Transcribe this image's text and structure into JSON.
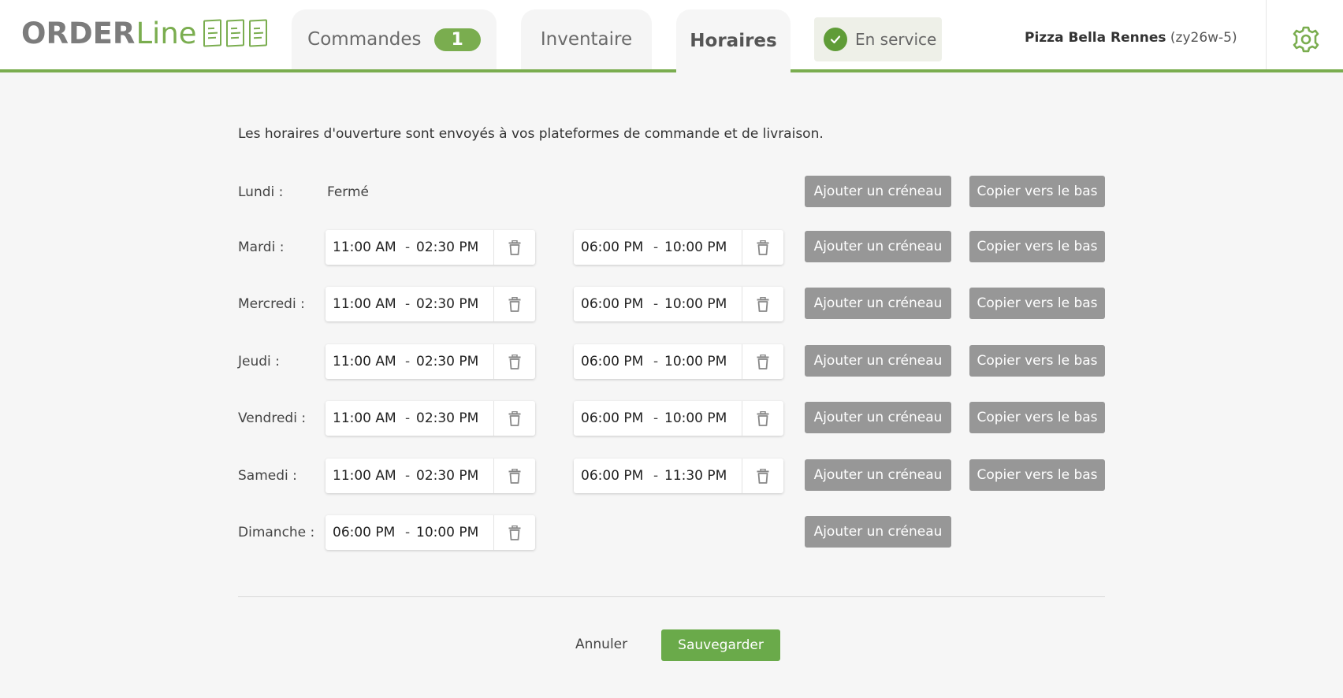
{
  "colors": {
    "accent": "#7aad4f",
    "button_gray": "#979797",
    "save_green": "#6aaa4a"
  },
  "header": {
    "logo": {
      "bold": "ORDER",
      "light": "Line"
    },
    "tabs": [
      {
        "label": "Commandes",
        "badge": "1"
      },
      {
        "label": "Inventaire"
      },
      {
        "label": "Horaires",
        "active": true
      }
    ],
    "status": {
      "label": "En service",
      "icon": "check-circle-icon"
    },
    "restaurant": {
      "name": "Pizza Bella Rennes",
      "code": "(zy26w-5)"
    },
    "settings_icon": "gear-icon"
  },
  "intro": "Les horaires d'ouverture sont envoyés à vos plateformes de commande et de livraison.",
  "labels": {
    "add_slot": "Ajouter un créneau",
    "copy_down": "Copier vers le bas",
    "dash": "-",
    "closed": "Fermé"
  },
  "days": [
    {
      "label": "Lundi :",
      "closed_text": "Fermé",
      "slots": []
    },
    {
      "label": "Mardi :",
      "slots": [
        {
          "from": "11:00 AM",
          "to": "02:30 PM"
        },
        {
          "from": "06:00 PM",
          "to": "10:00 PM"
        }
      ]
    },
    {
      "label": "Mercredi :",
      "slots": [
        {
          "from": "11:00 AM",
          "to": "02:30 PM"
        },
        {
          "from": "06:00 PM",
          "to": "10:00 PM"
        }
      ]
    },
    {
      "label": "Jeudi :",
      "slots": [
        {
          "from": "11:00 AM",
          "to": "02:30 PM"
        },
        {
          "from": "06:00 PM",
          "to": "10:00 PM"
        }
      ]
    },
    {
      "label": "Vendredi :",
      "slots": [
        {
          "from": "11:00 AM",
          "to": "02:30 PM"
        },
        {
          "from": "06:00 PM",
          "to": "10:00 PM"
        }
      ]
    },
    {
      "label": "Samedi :",
      "slots": [
        {
          "from": "11:00 AM",
          "to": "02:30 PM"
        },
        {
          "from": "06:00 PM",
          "to": "11:30 PM"
        }
      ]
    },
    {
      "label": "Dimanche :",
      "slots": [
        {
          "from": "06:00 PM",
          "to": "10:00 PM"
        }
      ]
    }
  ],
  "footer": {
    "cancel": "Annuler",
    "save": "Sauvegarder"
  }
}
